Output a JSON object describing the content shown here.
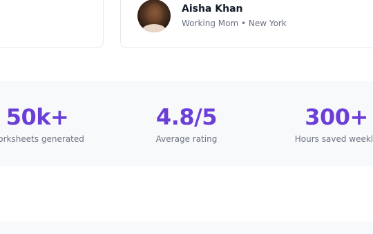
{
  "testimonial": {
    "author_name": "Aisha Khan",
    "author_meta": "Working Mom • New York"
  },
  "stats": [
    {
      "value": "50k+",
      "label": "Worksheets generated"
    },
    {
      "value": "4.8/5",
      "label": "Average rating"
    },
    {
      "value": "300+",
      "label": "Hours saved weekly"
    }
  ],
  "colors": {
    "accent": "#6b3fd6",
    "muted_text": "#6b7280",
    "band_bg": "#f8f9fb"
  }
}
